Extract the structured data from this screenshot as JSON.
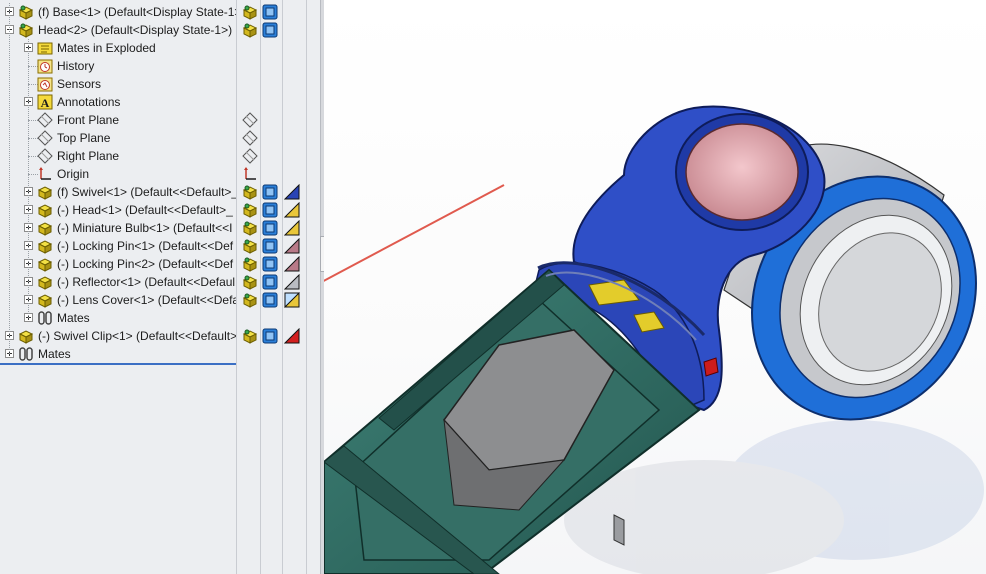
{
  "feature_tree": {
    "items": [
      {
        "label": "(f) Base<1> (Default<Display State-1>",
        "icon": "assembly-component-icon",
        "expander": "plus",
        "level": 0,
        "states": [
          "component-state-icon",
          "display-state-icon"
        ]
      },
      {
        "label": "Head<2> (Default<Display State-1>)",
        "icon": "assembly-component-icon",
        "expander": "minus",
        "level": 0,
        "states": [
          "component-state-icon",
          "display-state-icon"
        ]
      },
      {
        "label": "Mates in Exploded",
        "icon": "mates-in-exploded-icon",
        "expander": "plus",
        "level": 1,
        "states": []
      },
      {
        "label": "History",
        "icon": "history-icon",
        "expander": "none",
        "level": 1,
        "states": []
      },
      {
        "label": "Sensors",
        "icon": "sensors-icon",
        "expander": "none",
        "level": 1,
        "states": []
      },
      {
        "label": "Annotations",
        "icon": "annotations-icon",
        "expander": "plus",
        "level": 1,
        "states": []
      },
      {
        "label": "Front Plane",
        "icon": "plane-icon",
        "expander": "none",
        "level": 1,
        "states": [
          "plane-state-icon"
        ]
      },
      {
        "label": "Top Plane",
        "icon": "plane-icon",
        "expander": "none",
        "level": 1,
        "states": [
          "plane-state-icon"
        ]
      },
      {
        "label": "Right Plane",
        "icon": "plane-icon",
        "expander": "none",
        "level": 1,
        "states": [
          "plane-state-icon"
        ]
      },
      {
        "label": "Origin",
        "icon": "origin-icon",
        "expander": "none",
        "level": 1,
        "states": [
          "origin-state-icon"
        ]
      },
      {
        "label": "(f) Swivel<1> (Default<<Default>_",
        "icon": "part-icon",
        "expander": "plus",
        "level": 1,
        "states": [
          "component-state-icon",
          "display-state-icon",
          "appearance-blue-icon"
        ]
      },
      {
        "label": "(-) Head<1> (Default<<Default>_",
        "icon": "part-icon",
        "expander": "plus",
        "level": 1,
        "states": [
          "component-state-icon",
          "display-state-icon",
          "appearance-yellow-icon"
        ]
      },
      {
        "label": "(-) Miniature Bulb<1> (Default<<I",
        "icon": "part-icon",
        "expander": "plus",
        "level": 1,
        "states": [
          "component-state-icon",
          "display-state-icon",
          "appearance-yellow-icon"
        ]
      },
      {
        "label": "(-) Locking Pin<1> (Default<<Def",
        "icon": "part-icon",
        "expander": "plus",
        "level": 1,
        "states": [
          "component-state-icon",
          "display-state-icon",
          "appearance-mauve-icon"
        ]
      },
      {
        "label": "(-) Locking Pin<2> (Default<<Def",
        "icon": "part-icon",
        "expander": "plus",
        "level": 1,
        "states": [
          "component-state-icon",
          "display-state-icon",
          "appearance-mauve-icon"
        ]
      },
      {
        "label": "(-) Reflector<1> (Default<<Defaul",
        "icon": "part-icon",
        "expander": "plus",
        "level": 1,
        "states": [
          "component-state-icon",
          "display-state-icon",
          "appearance-gray-icon"
        ]
      },
      {
        "label": "(-) Lens Cover<1> (Default<<Defa",
        "icon": "part-icon",
        "expander": "plus",
        "level": 1,
        "states": [
          "component-state-icon",
          "display-state-icon",
          "appearance-glass-icon"
        ]
      },
      {
        "label": "Mates",
        "icon": "mates-icon",
        "expander": "plus",
        "level": 1,
        "states": []
      },
      {
        "label": "(-) Swivel Clip<1> (Default<<Default>",
        "icon": "part-icon",
        "expander": "plus",
        "level": 0,
        "states": [
          "component-state-icon",
          "display-state-icon",
          "appearance-red-icon"
        ]
      },
      {
        "label": "Mates",
        "icon": "mates-icon",
        "expander": "plus",
        "level": 0,
        "states": []
      }
    ]
  },
  "colors": {
    "panel_bg": "#eceef1",
    "flashlight_head_blue": "#2f4fc7",
    "lens_ring_blue": "#1f6fd8",
    "reflector_pink": "#e2a6ae",
    "body_green": "#2f6b62",
    "pointer_red": "#e05a4e"
  }
}
